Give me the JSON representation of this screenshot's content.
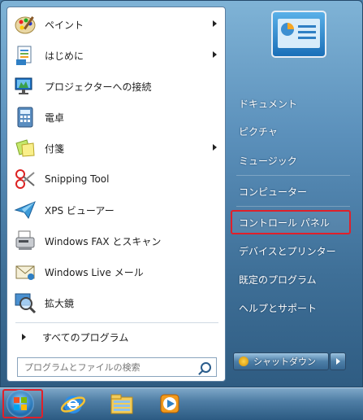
{
  "start_menu": {
    "programs": [
      {
        "label": "ペイント",
        "icon": "paint-icon",
        "has_submenu": true
      },
      {
        "label": "はじめに",
        "icon": "getting-started-icon",
        "has_submenu": true
      },
      {
        "label": "プロジェクターへの接続",
        "icon": "projector-icon",
        "has_submenu": false
      },
      {
        "label": "電卓",
        "icon": "calculator-icon",
        "has_submenu": false
      },
      {
        "label": "付箋",
        "icon": "sticky-notes-icon",
        "has_submenu": true
      },
      {
        "label": "Snipping Tool",
        "icon": "scissors-icon",
        "has_submenu": false
      },
      {
        "label": "XPS ビューアー",
        "icon": "xps-viewer-icon",
        "has_submenu": false
      },
      {
        "label": "Windows FAX とスキャン",
        "icon": "fax-icon",
        "has_submenu": false
      },
      {
        "label": "Windows Live メール",
        "icon": "mail-icon",
        "has_submenu": false
      },
      {
        "label": "拡大鏡",
        "icon": "magnifier-icon",
        "has_submenu": false
      }
    ],
    "all_programs": "すべてのプログラム",
    "search": {
      "placeholder": "プログラムとファイルの検索",
      "value": ""
    },
    "right_items": [
      "ドキュメント",
      "ピクチャ",
      "ミュージック",
      "コンピューター",
      "コントロール パネル",
      "デバイスとプリンター",
      "既定のプログラム",
      "ヘルプとサポート"
    ],
    "highlighted_item": "コントロール パネル",
    "shutdown_label": "シャットダウン"
  },
  "taskbar": {
    "start_icon": "windows-start-icon",
    "pinned": [
      "internet-explorer-icon",
      "file-explorer-icon",
      "media-player-icon"
    ]
  },
  "colors": {
    "highlight": "#e0202a",
    "menu_blue": "#5b90bb"
  }
}
